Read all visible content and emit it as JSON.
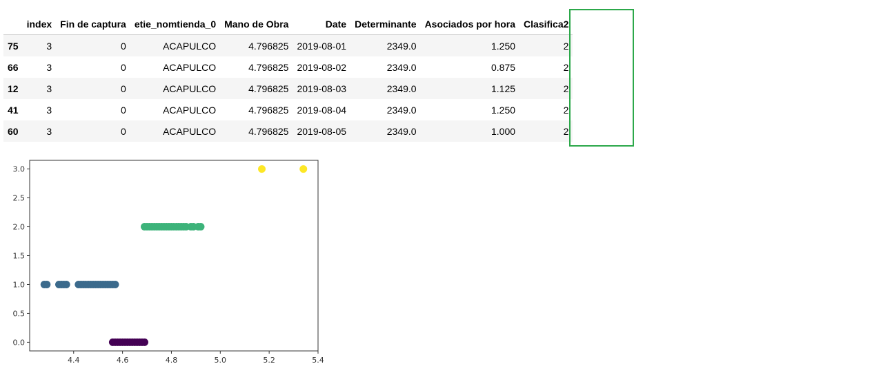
{
  "table": {
    "columns": [
      "",
      "index",
      "Fin de captura",
      "etie_nomtienda_0",
      "Mano de Obra",
      "Date",
      "Determinante",
      "Asociados por hora",
      "Clasifica2"
    ],
    "rows": [
      [
        "75",
        "3",
        "0",
        "ACAPULCO",
        "4.796825",
        "2019-08-01",
        "2349.0",
        "1.250",
        "2"
      ],
      [
        "66",
        "3",
        "0",
        "ACAPULCO",
        "4.796825",
        "2019-08-02",
        "2349.0",
        "0.875",
        "2"
      ],
      [
        "12",
        "3",
        "0",
        "ACAPULCO",
        "4.796825",
        "2019-08-03",
        "2349.0",
        "1.125",
        "2"
      ],
      [
        "41",
        "3",
        "0",
        "ACAPULCO",
        "4.796825",
        "2019-08-04",
        "2349.0",
        "1.250",
        "2"
      ],
      [
        "60",
        "3",
        "0",
        "ACAPULCO",
        "4.796825",
        "2019-08-05",
        "2349.0",
        "1.000",
        "2"
      ]
    ],
    "highlight_color": "#2ca84a"
  },
  "chart_data": {
    "type": "scatter",
    "xlim": [
      4.22,
      5.4
    ],
    "ylim": [
      -0.15,
      3.15
    ],
    "x_ticks": [
      "4.4",
      "4.6",
      "4.8",
      "5.0",
      "5.2",
      "5.4"
    ],
    "y_ticks": [
      "0.0",
      "0.5",
      "1.0",
      "1.5",
      "2.0",
      "2.5",
      "3.0"
    ],
    "grid": false,
    "series": [
      {
        "color": "#440154",
        "points": [
          [
            4.56,
            0
          ],
          [
            4.57,
            0
          ],
          [
            4.58,
            0
          ],
          [
            4.59,
            0
          ],
          [
            4.6,
            0
          ],
          [
            4.61,
            0
          ],
          [
            4.62,
            0
          ],
          [
            4.63,
            0
          ],
          [
            4.64,
            0
          ],
          [
            4.65,
            0
          ],
          [
            4.66,
            0
          ],
          [
            4.67,
            0
          ],
          [
            4.68,
            0
          ],
          [
            4.69,
            0
          ]
        ]
      },
      {
        "color": "#3b6a8c",
        "points": [
          [
            4.28,
            1
          ],
          [
            4.29,
            1
          ],
          [
            4.34,
            1
          ],
          [
            4.35,
            1
          ],
          [
            4.36,
            1
          ],
          [
            4.37,
            1
          ],
          [
            4.42,
            1
          ],
          [
            4.43,
            1
          ],
          [
            4.44,
            1
          ],
          [
            4.45,
            1
          ],
          [
            4.46,
            1
          ],
          [
            4.47,
            1
          ],
          [
            4.48,
            1
          ],
          [
            4.49,
            1
          ],
          [
            4.5,
            1
          ],
          [
            4.51,
            1
          ],
          [
            4.52,
            1
          ],
          [
            4.53,
            1
          ],
          [
            4.54,
            1
          ],
          [
            4.55,
            1
          ],
          [
            4.56,
            1
          ],
          [
            4.57,
            1
          ]
        ]
      },
      {
        "color": "#3db37a",
        "points": [
          [
            4.69,
            2
          ],
          [
            4.7,
            2
          ],
          [
            4.71,
            2
          ],
          [
            4.72,
            2
          ],
          [
            4.73,
            2
          ],
          [
            4.74,
            2
          ],
          [
            4.75,
            2
          ],
          [
            4.76,
            2
          ],
          [
            4.77,
            2
          ],
          [
            4.78,
            2
          ],
          [
            4.79,
            2
          ],
          [
            4.8,
            2
          ],
          [
            4.81,
            2
          ],
          [
            4.82,
            2
          ],
          [
            4.83,
            2
          ],
          [
            4.84,
            2
          ],
          [
            4.85,
            2
          ],
          [
            4.86,
            2
          ],
          [
            4.88,
            2
          ],
          [
            4.89,
            2
          ],
          [
            4.91,
            2
          ],
          [
            4.92,
            2
          ]
        ]
      },
      {
        "color": "#fde725",
        "points": [
          [
            5.17,
            3
          ],
          [
            5.34,
            3
          ]
        ]
      }
    ]
  }
}
